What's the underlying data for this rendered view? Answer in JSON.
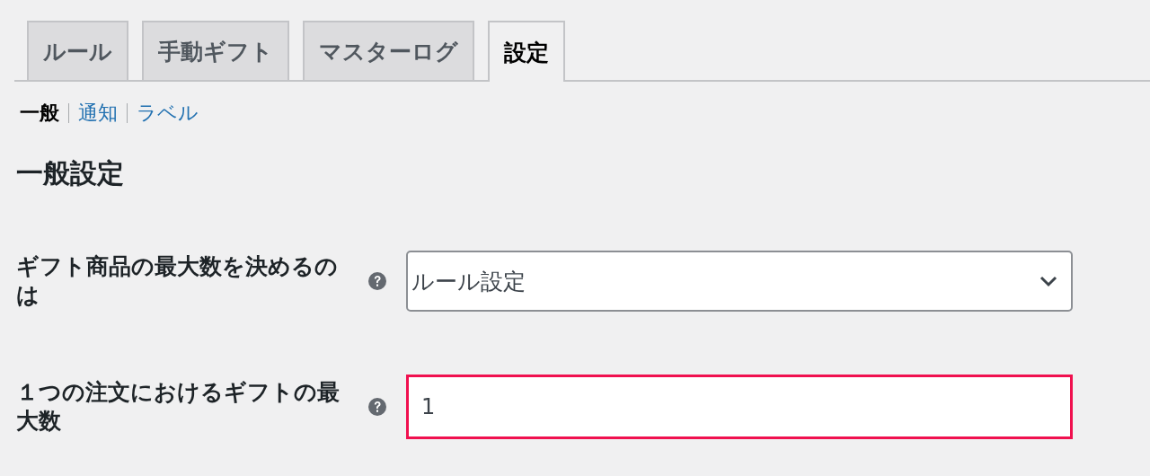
{
  "tabs": [
    {
      "label": "ルール",
      "selected": false
    },
    {
      "label": "手動ギフト",
      "selected": false
    },
    {
      "label": "マスターログ",
      "selected": false
    },
    {
      "label": "設定",
      "selected": true
    }
  ],
  "subnav": [
    {
      "label": "一般",
      "selected": true
    },
    {
      "label": "通知",
      "selected": false
    },
    {
      "label": "ラベル",
      "selected": false
    }
  ],
  "heading": "一般設定",
  "settings": [
    {
      "kind": "select",
      "label": "ギフト商品の最大数を決めるのは",
      "value": "ルール設定",
      "highlighted": false
    },
    {
      "kind": "text",
      "label": "１つの注文におけるギフトの最大数",
      "value": "1",
      "highlighted": true
    }
  ]
}
